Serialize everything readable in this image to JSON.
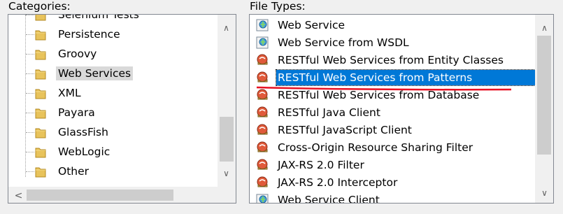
{
  "categories": {
    "label": "Categories:",
    "items": [
      {
        "label": "Selenium Tests"
      },
      {
        "label": "Persistence"
      },
      {
        "label": "Groovy"
      },
      {
        "label": "Web Services",
        "selected": true
      },
      {
        "label": "XML"
      },
      {
        "label": "Payara"
      },
      {
        "label": "GlassFish"
      },
      {
        "label": "WebLogic"
      },
      {
        "label": "Other"
      }
    ]
  },
  "file_types": {
    "label": "File Types:",
    "items": [
      {
        "label": "Web Service",
        "icon": "web-service-icon"
      },
      {
        "label": "Web Service from WSDL",
        "icon": "web-service-icon"
      },
      {
        "label": "RESTful Web Services from Entity Classes",
        "icon": "rest-icon"
      },
      {
        "label": "RESTful Web Services from Patterns",
        "icon": "rest-icon",
        "selected": true
      },
      {
        "label": "RESTful Web Services from Database",
        "icon": "rest-icon"
      },
      {
        "label": "RESTful Java Client",
        "icon": "rest-icon"
      },
      {
        "label": "RESTful JavaScript Client",
        "icon": "rest-icon"
      },
      {
        "label": "Cross-Origin Resource Sharing Filter",
        "icon": "rest-icon"
      },
      {
        "label": "JAX-RS 2.0 Filter",
        "icon": "rest-icon"
      },
      {
        "label": "JAX-RS 2.0 Interceptor",
        "icon": "rest-icon"
      },
      {
        "label": "Web Service Client",
        "icon": "web-service-client-icon"
      }
    ]
  },
  "colors": {
    "selection": "#0078d7",
    "annotation_underline": "#e81123",
    "category_selection": "#d9d9d9"
  }
}
